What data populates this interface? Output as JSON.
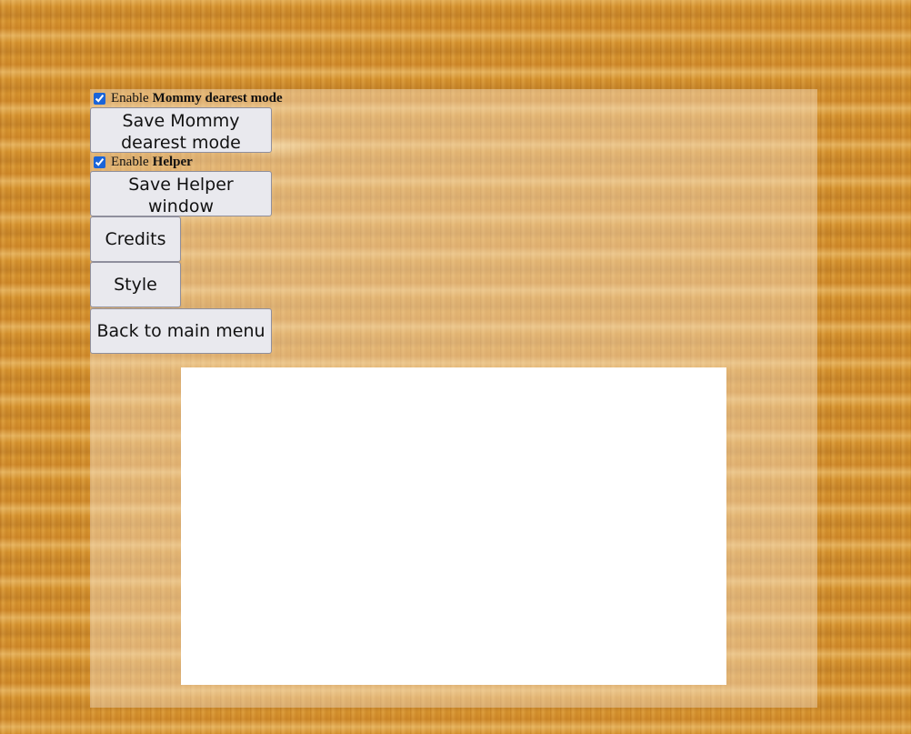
{
  "settings": {
    "mommy": {
      "enable_prefix": "Enable",
      "enable_bold": "Mommy dearest mode",
      "checked": true,
      "save_label": "Save Mommy dearest mode"
    },
    "helper": {
      "enable_prefix": "Enable",
      "enable_bold": "Helper",
      "checked": true,
      "save_label": "Save Helper window"
    }
  },
  "buttons": {
    "credits": "Credits",
    "style": "Style",
    "back": "Back to main menu"
  },
  "colors": {
    "checkbox_accent": "#1a64d8",
    "button_bg": "#e9e9ee",
    "wood": "#d8952f"
  }
}
